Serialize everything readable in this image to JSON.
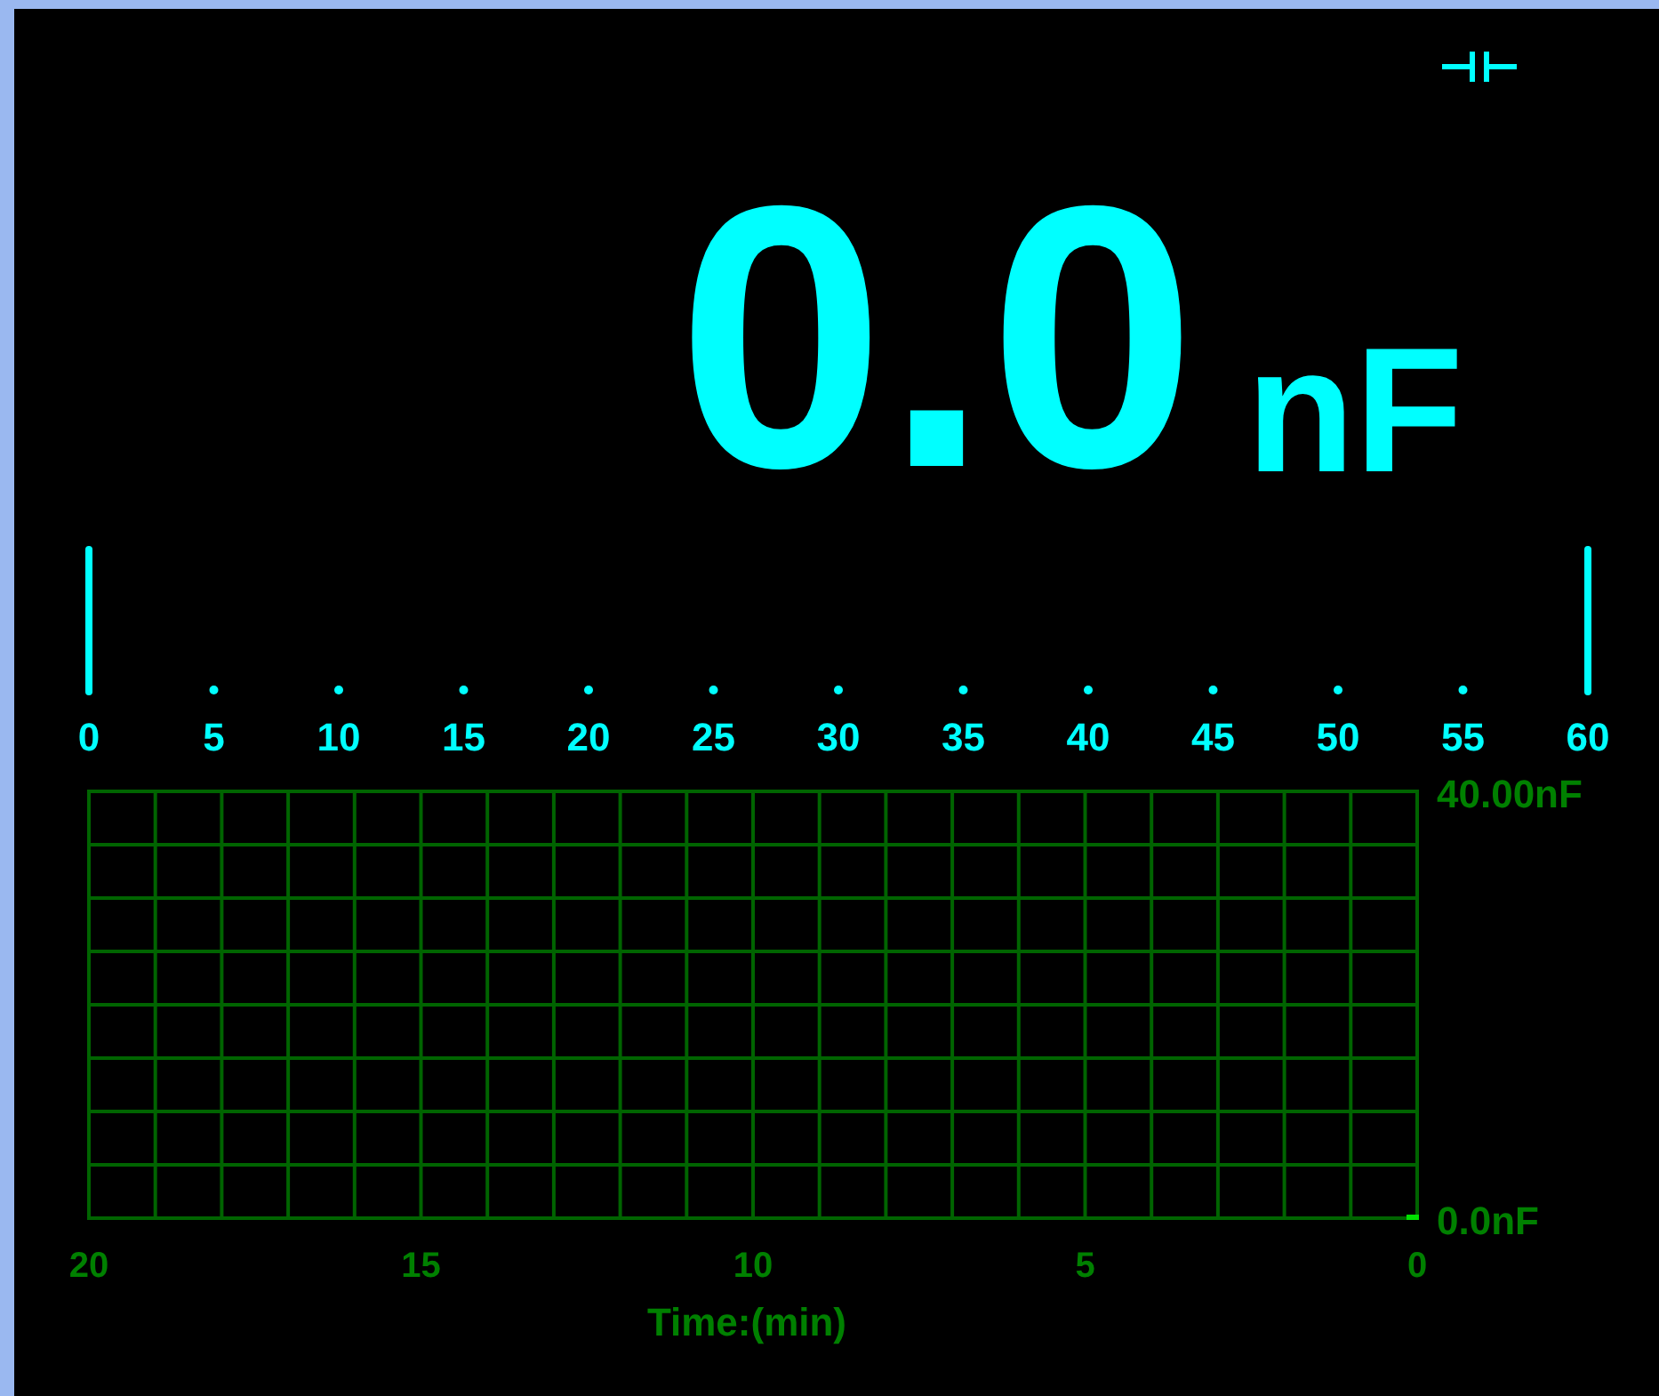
{
  "reading": {
    "value": "0.0",
    "unit": "nF"
  },
  "bar_graph": {
    "scale_labels": [
      "0",
      "5",
      "10",
      "15",
      "20",
      "25",
      "30",
      "35",
      "40",
      "45",
      "50",
      "55",
      "60"
    ]
  },
  "trend": {
    "chart_data": {
      "type": "line",
      "xlabel": "Time:(min)",
      "x": [
        0
      ],
      "series": [
        {
          "color": "#00e000",
          "marker": "square",
          "values": [
            0
          ]
        }
      ],
      "grid": true,
      "xlim": [
        20,
        0
      ],
      "ylim": [
        0,
        40
      ],
      "xticks": [
        20,
        15,
        10,
        5,
        0
      ],
      "yticks": [
        {
          "value": 40,
          "label": "40.00nF"
        },
        {
          "value": 0,
          "label": "0.0nF"
        }
      ]
    }
  }
}
